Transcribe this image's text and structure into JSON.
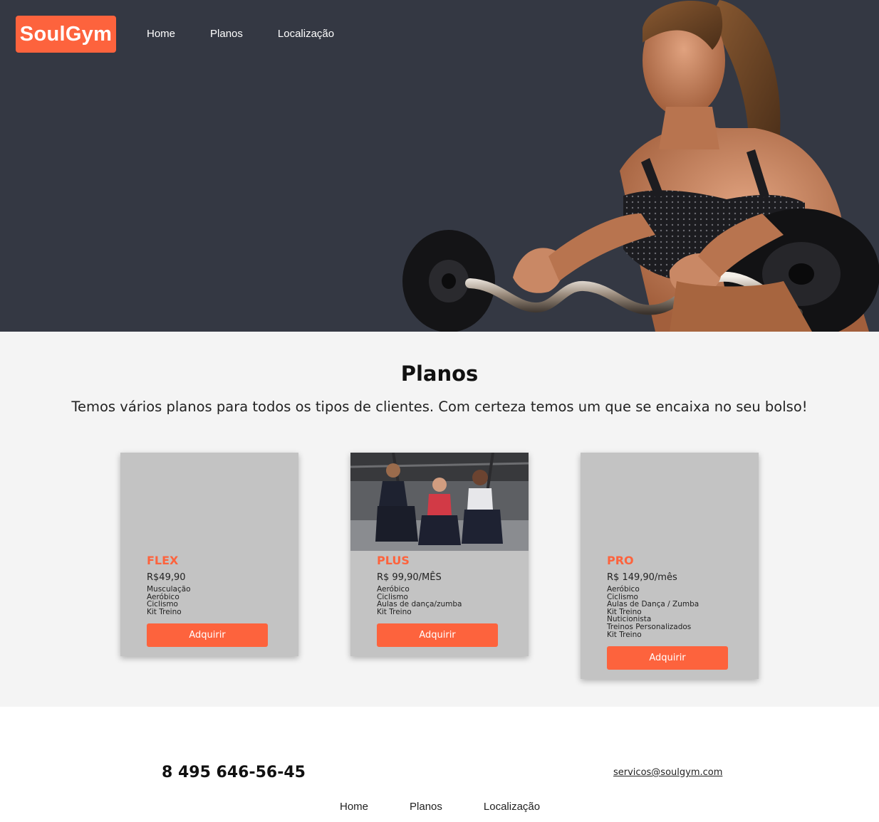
{
  "header": {
    "logo": "SoulGym",
    "nav": [
      "Home",
      "Planos",
      "Localização"
    ]
  },
  "planos": {
    "title": "Planos",
    "subtitle": "Temos vários planos para todos os tipos de clientes. Com certeza temos um que se encaixa no seu bolso!",
    "cards": [
      {
        "name": "FLEX",
        "price": "R$49,90",
        "features": [
          "Musculação",
          "Aeróbico",
          "Ciclismo",
          "Kit Treino"
        ],
        "button": "Adquirir"
      },
      {
        "name": "PLUS",
        "price": "R$ 99,90/MÊS",
        "features": [
          "Aeróbico",
          "Ciclismo",
          "Aulas de dança/zumba",
          "Kit Treino"
        ],
        "button": "Adquirir"
      },
      {
        "name": "PRO",
        "price": "R$ 149,90/mês",
        "features": [
          "Aeróbico",
          "Ciclismo",
          "Aulas de Dança / Zumba",
          "Kit Treino",
          "Nuticionista",
          "Treinos Personalizados",
          "Kit Treino"
        ],
        "button": "Adquirir"
      }
    ]
  },
  "footer": {
    "phone": "8 495 646-56-45",
    "email": "servicos@soulgym.com",
    "nav": [
      "Home",
      "Planos",
      "Localização"
    ]
  },
  "colors": {
    "accent": "#fd633d",
    "hero_bg": "#343843",
    "section_bg": "#f4f4f4",
    "card_bg": "#c3c3c3"
  }
}
